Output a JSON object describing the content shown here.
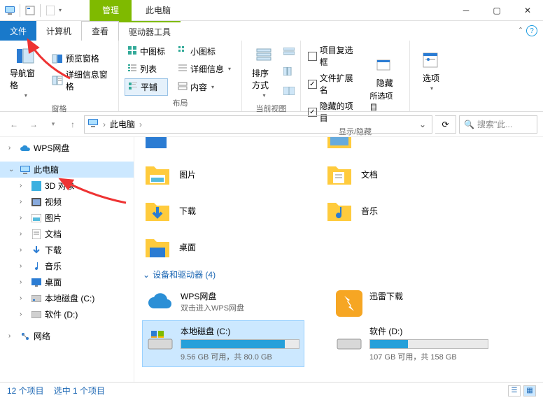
{
  "titlebar": {
    "manage_tab": "管理",
    "title": "此电脑"
  },
  "menu": {
    "file": "文件",
    "computer": "计算机",
    "view": "查看",
    "drive_tools": "驱动器工具"
  },
  "ribbon": {
    "pane": {
      "nav": "导航窗格",
      "preview": "预览窗格",
      "details": "详细信息窗格",
      "group": "窗格"
    },
    "layout": {
      "medium_icons": "中图标",
      "small_icons": "小图标",
      "list": "列表",
      "details": "详细信息",
      "tiles": "平铺",
      "content": "内容",
      "group": "布局"
    },
    "currentview": {
      "sort": "排序方式",
      "group": "当前视图"
    },
    "showhide": {
      "item_checkboxes": "项目复选框",
      "file_ext": "文件扩展名",
      "hidden_items": "隐藏的项目",
      "hide": "隐藏",
      "hide_sub": "所选项目",
      "group": "显示/隐藏"
    },
    "options": {
      "label": "选项"
    }
  },
  "addressbar": {
    "root": "此电脑",
    "search_placeholder": "搜索\"此..."
  },
  "sidebar": {
    "wps": "WPS网盘",
    "thispc": "此电脑",
    "items": [
      {
        "label": "3D 对象"
      },
      {
        "label": "视频"
      },
      {
        "label": "图片"
      },
      {
        "label": "文档"
      },
      {
        "label": "下载"
      },
      {
        "label": "音乐"
      },
      {
        "label": "桌面"
      },
      {
        "label": "本地磁盘 (C:)"
      },
      {
        "label": "软件 (D:)"
      }
    ],
    "network": "网络"
  },
  "content": {
    "folders": {
      "pictures": "图片",
      "documents": "文档",
      "downloads": "下载",
      "music": "音乐",
      "desktop": "桌面"
    },
    "section": "设备和驱动器 (4)",
    "wps": {
      "name": "WPS网盘",
      "sub": "双击进入WPS网盘"
    },
    "xunlei": "迅雷下载",
    "drive_c": {
      "name": "本地磁盘 (C:)",
      "sub": "9.56 GB 可用，共 80.0 GB",
      "pct": 88
    },
    "drive_d": {
      "name": "软件 (D:)",
      "sub": "107 GB 可用，共 158 GB",
      "pct": 32
    }
  },
  "statusbar": {
    "items": "12 个项目",
    "selected": "选中 1 个项目"
  }
}
